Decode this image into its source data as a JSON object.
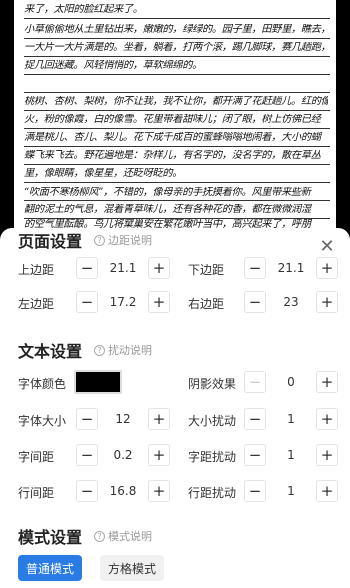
{
  "preview": {
    "lines": [
      "来了，太阳的脸红起来了。",
      "小草偷偷地从土里钻出来，嫩嫩的，绿绿的。园子里，田野里，瞧去，",
      "一大片一大片满是的。坐着，躺着，打两个滚，踢几脚球，赛几趟跑，",
      "捉几回迷藏。风轻悄悄的，草软绵绵的。",
      "桃树、杏树、梨树，你不让我，我不让你，都开满了花赶趟儿。红的像",
      "火，粉的像霞，白的像雪。花里带着甜味儿；闭了眼，树上仿佛已经",
      "满是桃儿、杏儿、梨儿。花下成千成百的蜜蜂嗡嗡地闹着，大小的蝴",
      "蝶飞来飞去。野花遍地是：杂样儿，有名字的，没名字的，散在草丛",
      "里，像眼睛，像星星，还眨呀眨的。",
      "“吹面不寒杨柳风”，不错的，像母亲的手抚摸着你。风里带来些新",
      "翻的泥土的气息，混着青草味儿，还有各种花的香，都在微微润湿",
      "的空气里酝酿。鸟儿将窠巢安在繁花嫩叶当中，高兴起来了，呼朋"
    ]
  },
  "page_settings": {
    "title": "页面设置",
    "help_label": "边距说明",
    "top_margin_label": "上边距",
    "top_margin": "21.1",
    "bottom_margin_label": "下边距",
    "bottom_margin": "21.1",
    "left_margin_label": "左边距",
    "left_margin": "17.2",
    "right_margin_label": "右边距",
    "right_margin": "23"
  },
  "text_settings": {
    "title": "文本设置",
    "help_label": "扰动说明",
    "font_color_label": "字体颜色",
    "font_color": "#000000",
    "shadow_label": "阴影效果",
    "shadow": "0",
    "font_size_label": "字体大小",
    "font_size": "12",
    "size_jitter_label": "大小扰动",
    "size_jitter": "1",
    "char_spacing_label": "字间距",
    "char_spacing": "0.2",
    "char_jitter_label": "字距扰动",
    "char_jitter": "1",
    "line_spacing_label": "行间距",
    "line_spacing": "16.8",
    "line_jitter_label": "行距扰动",
    "line_jitter": "1"
  },
  "mode_settings": {
    "title": "模式设置",
    "help_label": "模式说明",
    "normal_mode": "普通模式",
    "grid_mode": "方格模式"
  },
  "icons": {
    "close": "close-icon",
    "help": "question-circle-icon",
    "minus": "minus-icon",
    "plus": "plus-icon"
  },
  "colors": {
    "accent": "#2a7be4",
    "font_swatch": "#000000"
  }
}
